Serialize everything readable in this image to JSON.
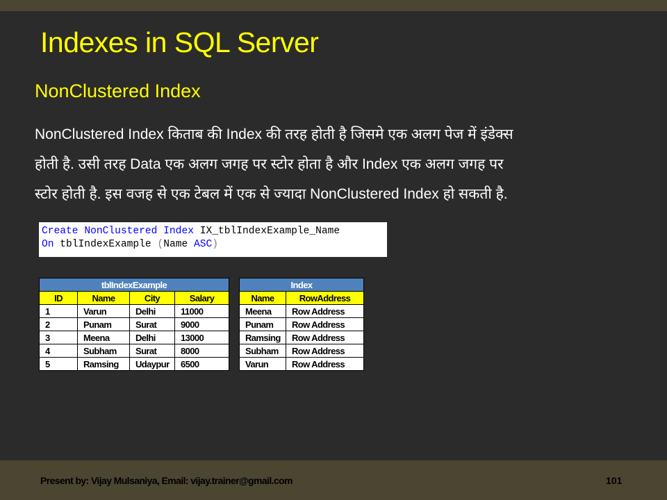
{
  "slide": {
    "title": "Indexes in SQL Server",
    "subtitle": "NonClustered Index",
    "body_lines": [
      "NonClustered Index किताब की Index की तरह होती है जिसमे एक अलग पेज में इंडेक्स",
      "होती है. उसी तरह Data एक अलग जगह पर स्टोर होता है और Index एक अलग जगह पर",
      "स्टोर होती है. इस वजह से  एक टेबल में एक से ज्यादा NonClustered Index हो सकती है."
    ]
  },
  "code": {
    "line1": {
      "kw1": "Create",
      "kw2": "NonClustered",
      "kw3": "Index",
      "name": "IX_tblIndexExample_Name"
    },
    "line2": {
      "kw1": "On",
      "table": "tblIndexExample",
      "paren_open": "(",
      "column": "Name",
      "order": "ASC",
      "paren_close": ")"
    }
  },
  "table1": {
    "caption": "tblIndexExample",
    "headers": [
      "ID",
      "Name",
      "City",
      "Salary"
    ],
    "rows": [
      [
        "1",
        "Varun",
        "Delhi",
        "11000"
      ],
      [
        "2",
        "Punam",
        "Surat",
        "9000"
      ],
      [
        "3",
        "Meena",
        "Delhi",
        "13000"
      ],
      [
        "4",
        "Subham",
        "Surat",
        "8000"
      ],
      [
        "5",
        "Ramsing",
        "Udaypur",
        "6500"
      ]
    ]
  },
  "table2": {
    "caption": "Index",
    "headers": [
      "Name",
      "RowAddress"
    ],
    "rows": [
      [
        "Meena",
        "Row Address"
      ],
      [
        "Punam",
        "Row Address"
      ],
      [
        "Ramsing",
        "Row Address"
      ],
      [
        "Subham",
        "Row Address"
      ],
      [
        "Varun",
        "Row Address"
      ]
    ]
  },
  "footer": {
    "presenter": "Present by: Vijay Mulsaniya,  Email: vijay.trainer@gmail.com",
    "page_number": "101"
  },
  "colors": {
    "background": "#2b2b2b",
    "bar": "#4b4632",
    "title": "#ffff00",
    "table_caption": "#4f81bd",
    "table_header": "#ffff00",
    "code_keyword": "#0000ff"
  }
}
